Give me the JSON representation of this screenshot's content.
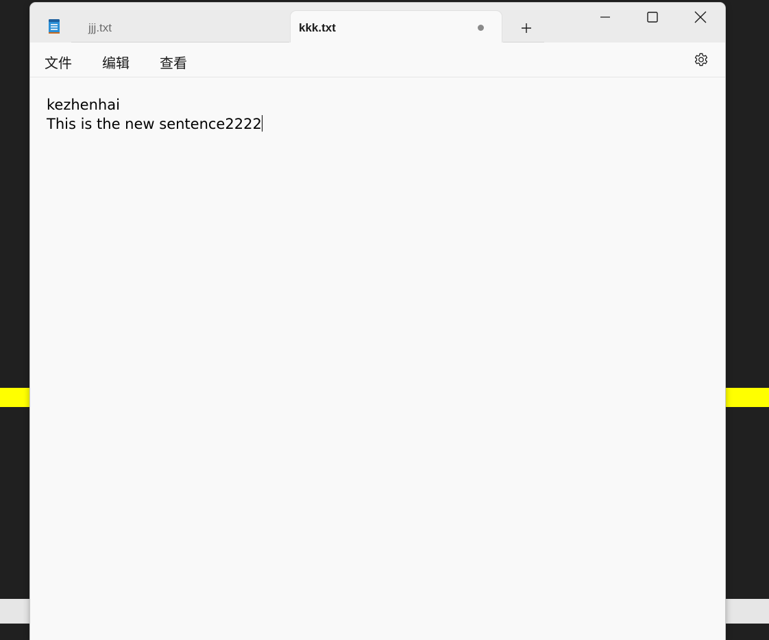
{
  "tabs": [
    {
      "label": "jjj.txt",
      "active": false
    },
    {
      "label": "kkk.txt",
      "active": true,
      "unsaved": true
    }
  ],
  "new_tab_label": "+",
  "menu": {
    "file": "文件",
    "edit": "编辑",
    "view": "查看"
  },
  "editor": {
    "lines": [
      "kezhenhai",
      "This is the new sentence2222"
    ]
  },
  "icons": {
    "app": "notepad-icon",
    "settings": "gear-icon",
    "minimize": "minimize-icon",
    "maximize": "maximize-icon",
    "close": "close-icon"
  },
  "colors": {
    "titlebar": "#ebebeb",
    "editor_background": "#f9f9f9",
    "desktop": "#202020",
    "highlight_stripe": "#ffff00"
  }
}
